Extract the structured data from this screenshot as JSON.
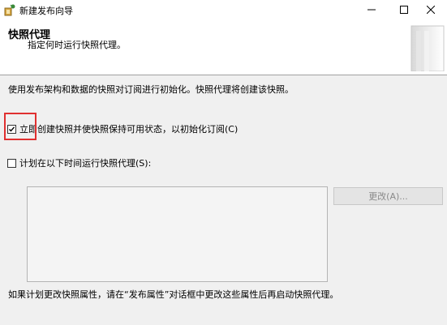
{
  "window": {
    "title": "新建发布向导"
  },
  "header": {
    "title": "快照代理",
    "subtitle": "指定何时运行快照代理。"
  },
  "description": "使用发布架构和数据的快照对订阅进行初始化。快照代理将创建该快照。",
  "options": {
    "immediate_label": "立即创建快照并使快照保持可用状态，以初始化订阅(C)",
    "immediate_checked": true,
    "schedule_label": "计划在以下时间运行快照代理(S):",
    "schedule_checked": false
  },
  "change_button_label": "更改(A)...",
  "footer_note": "如果计划更改快照属性，请在“发布属性”对话框中更改这些属性后再启动快照代理。",
  "colors": {
    "highlight_border": "#e03030",
    "disabled_text": "#8a8a8a"
  }
}
